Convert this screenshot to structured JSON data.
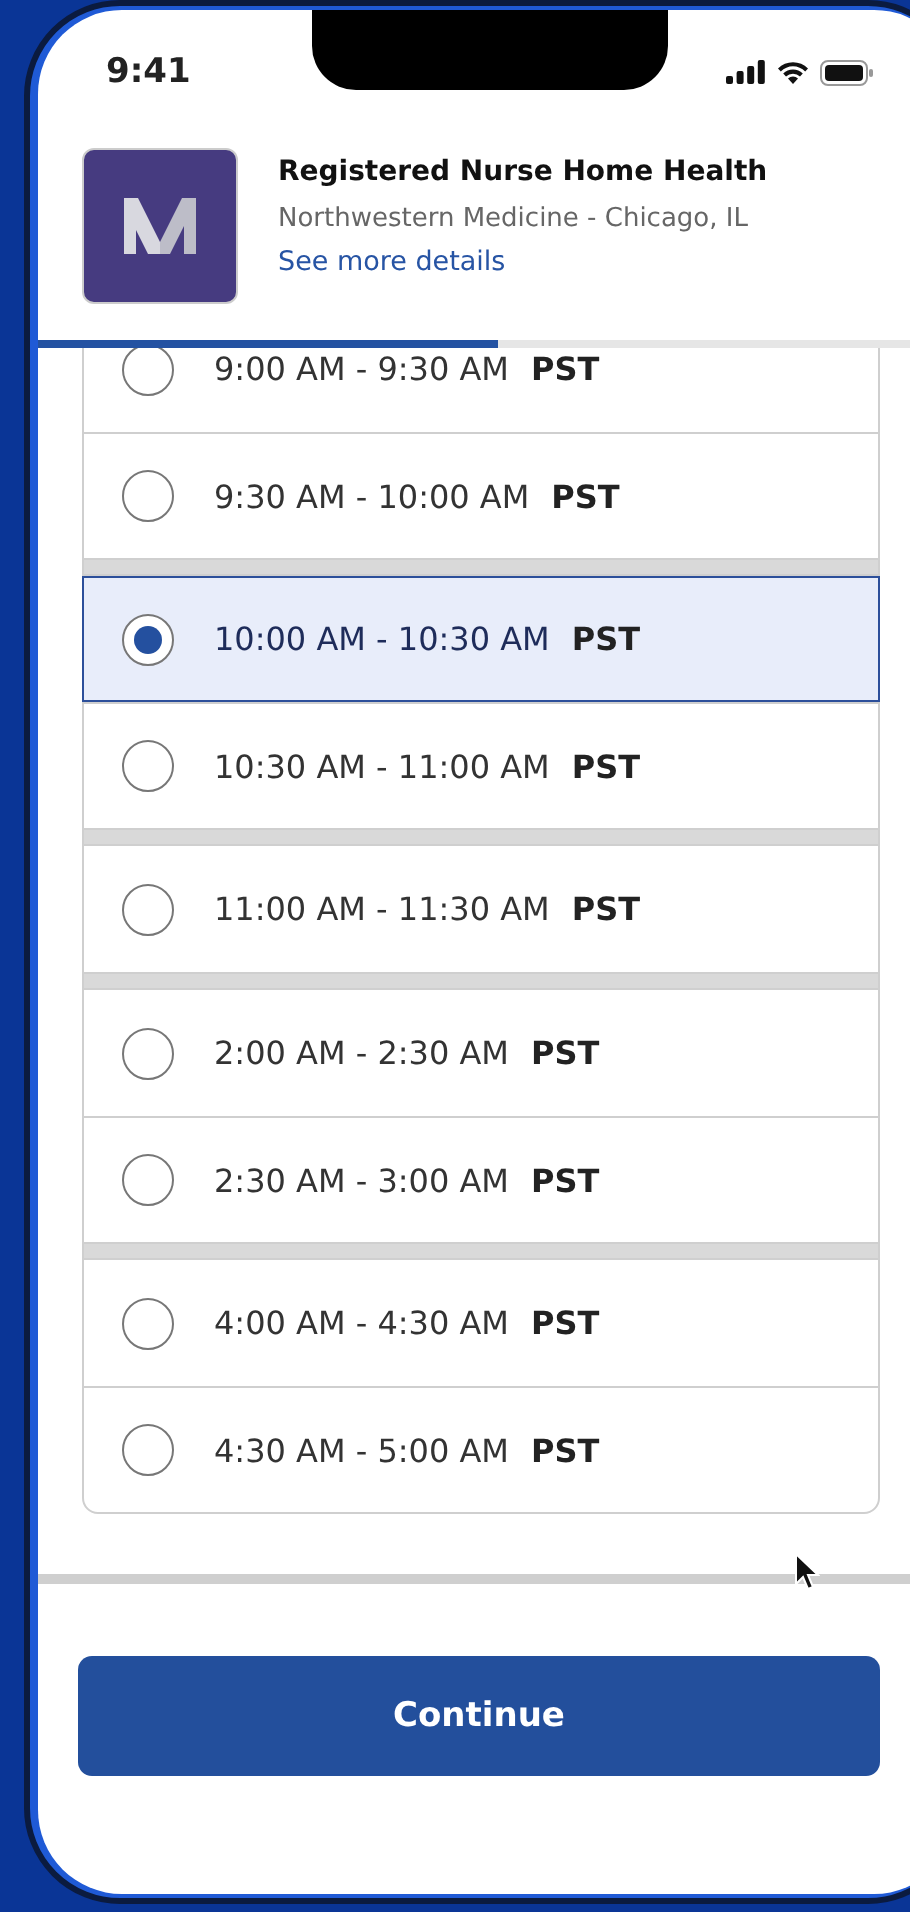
{
  "status_bar": {
    "time": "9:41"
  },
  "job": {
    "title": "Registered Nurse Home Health",
    "employer": "Northwestern Medicine - Chicago, IL",
    "link": "See more details"
  },
  "progress": {
    "level": 0.5
  },
  "slot_groups": [
    {
      "slots": [
        {
          "time": "9:00 AM - 9:30 AM",
          "zone": "PST",
          "selected": false
        },
        {
          "time": "9:30 AM - 10:00 AM",
          "zone": "PST",
          "selected": false
        }
      ]
    },
    {
      "slots": [
        {
          "time": "10:00 AM - 10:30 AM",
          "zone": "PST",
          "selected": true
        },
        {
          "time": "10:30 AM - 11:00 AM",
          "zone": "PST",
          "selected": false
        }
      ]
    },
    {
      "slots": [
        {
          "time": "11:00 AM - 11:30 AM",
          "zone": "PST",
          "selected": false
        }
      ]
    },
    {
      "slots": [
        {
          "time": "2:00 AM - 2:30 AM",
          "zone": "PST",
          "selected": false
        },
        {
          "time": "2:30 AM - 3:00 AM",
          "zone": "PST",
          "selected": false
        }
      ]
    },
    {
      "slots": [
        {
          "time": "4:00 AM - 4:30 AM",
          "zone": "PST",
          "selected": false
        },
        {
          "time": "4:30 AM - 5:00 AM",
          "zone": "PST",
          "selected": false
        }
      ]
    }
  ],
  "button": {
    "label": "Continue"
  }
}
